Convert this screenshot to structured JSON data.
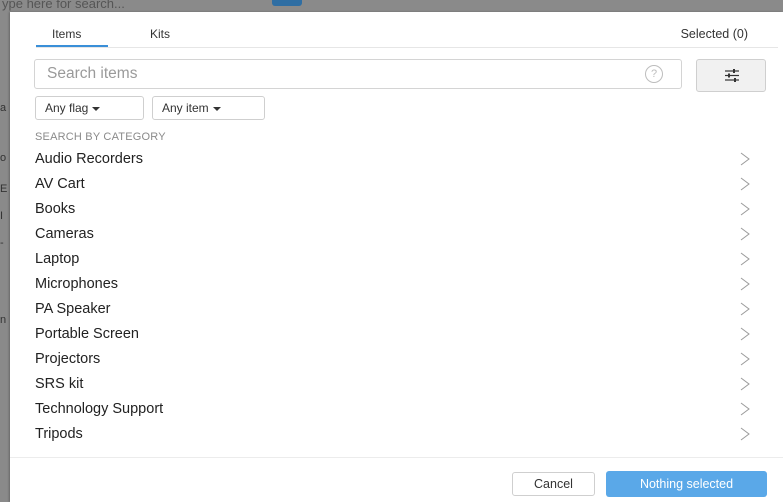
{
  "background": {
    "top_text": "ype here for search...",
    "left_fragments": [
      "a",
      "o",
      "E",
      "I",
      "-",
      "n"
    ]
  },
  "tabs": {
    "items_label": "Items",
    "kits_label": "Kits",
    "selected_label": "Selected (0)"
  },
  "search": {
    "placeholder": "Search items",
    "value": "",
    "help_symbol": "?"
  },
  "filters": {
    "flag_label": "Any flag",
    "item_label": "Any item"
  },
  "section_label": "SEARCH BY CATEGORY",
  "categories": [
    "Audio Recorders",
    "AV Cart",
    "Books",
    "Cameras",
    "Laptop",
    "Microphones",
    "PA Speaker",
    "Portable Screen",
    "Projectors",
    "SRS kit",
    "Technology Support",
    "Tripods"
  ],
  "footer": {
    "cancel_label": "Cancel",
    "primary_label": "Nothing selected"
  },
  "colors": {
    "accent": "#5aa8e8",
    "tab_underline": "#3a8fd8"
  },
  "icons": {
    "help": "help-icon",
    "filter": "sliders-icon",
    "chevron": "chevron-right-icon",
    "caret": "caret-down-icon"
  }
}
